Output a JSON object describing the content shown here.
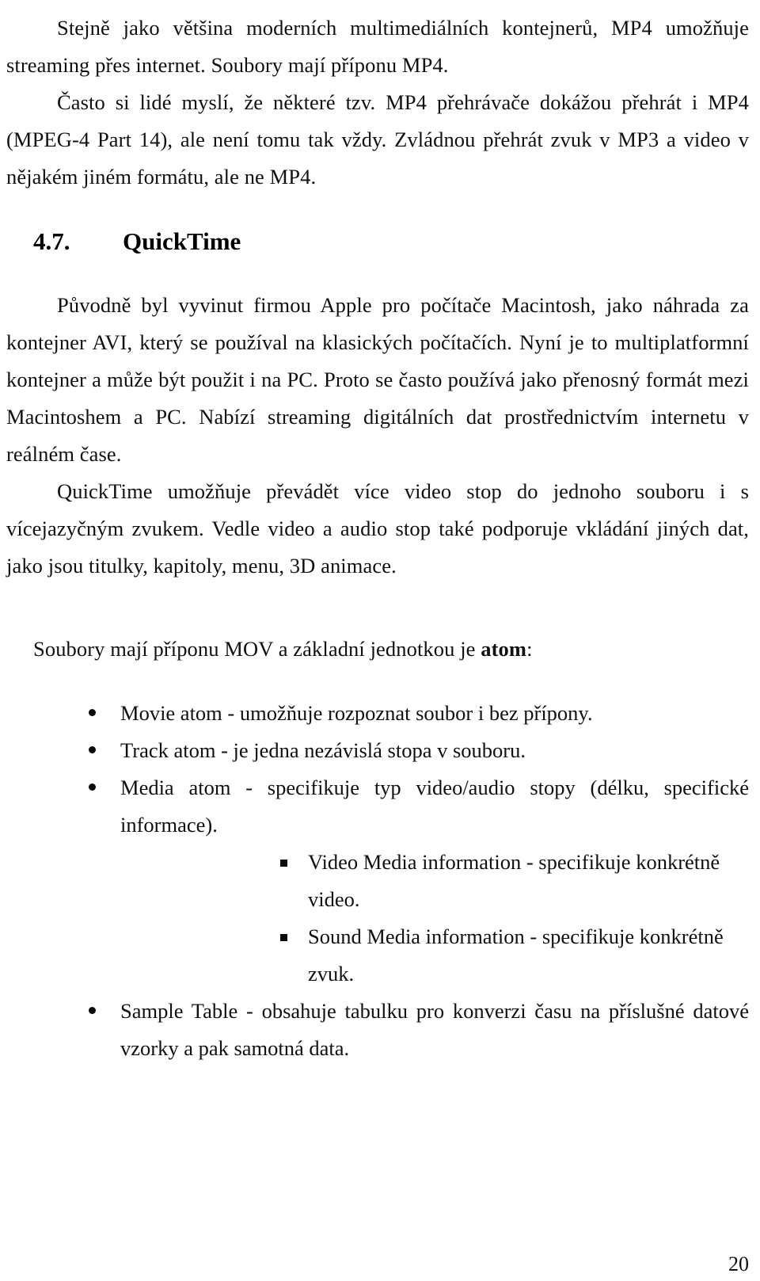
{
  "document": {
    "language": "cs",
    "page_number": "20",
    "paragraphs": {
      "intro_mp4": "Stejně jako většina moderních multimediálních kontejnerů, MP4 umožňuje streaming přes internet. Soubory mají příponu MP4.",
      "mp4_players": "Často si lidé myslí, že některé tzv. MP4 přehrávače dokážou přehrát i MP4 (MPEG-4 Part 14), ale není tomu tak vždy. Zvládnou přehrát zvuk v MP3 a video v nějakém jiném formátu, ale ne MP4.",
      "quicktime_origin": "Původně byl vyvinut firmou Apple pro počítače Macintosh, jako náhrada za kontejner AVI, který se používal na klasických počítačích. Nyní je to multiplatformní kontejner a může být použit i na PC. Proto se často používá jako přenosný formát mezi Macintoshem a PC. Nabízí streaming digitálních dat prostřednictvím internetu v reálném čase.",
      "quicktime_tracks": "QuickTime umožňuje převádět více video stop do jednoho souboru i s vícejazyčným zvukem. Vedle video a audio stop také podporuje vkládání jiných dat, jako jsou titulky, kapitoly, menu, 3D animace.",
      "mov_atom_prefix": "Soubory mají příponu MOV a základní jednotkou je ",
      "mov_atom_bold": "atom",
      "mov_atom_suffix": ":"
    },
    "heading": {
      "number": "4.7.",
      "title": "QuickTime"
    },
    "atom_list": [
      {
        "text": "Movie atom - umožňuje rozpoznat soubor i bez přípony.",
        "children": []
      },
      {
        "text": "Track atom - je jedna nezávislá stopa v souboru.",
        "children": []
      },
      {
        "text": "Media atom - specifikuje typ video/audio stopy (délku, specifické informace).",
        "children": [
          "Video Media information - specifikuje konkrétně video.",
          "Sound Media information - specifikuje konkrétně zvuk."
        ]
      },
      {
        "text": "Sample Table - obsahuje tabulku pro konverzi času na příslušné datové vzorky a pak samotná data.",
        "children": []
      }
    ]
  }
}
